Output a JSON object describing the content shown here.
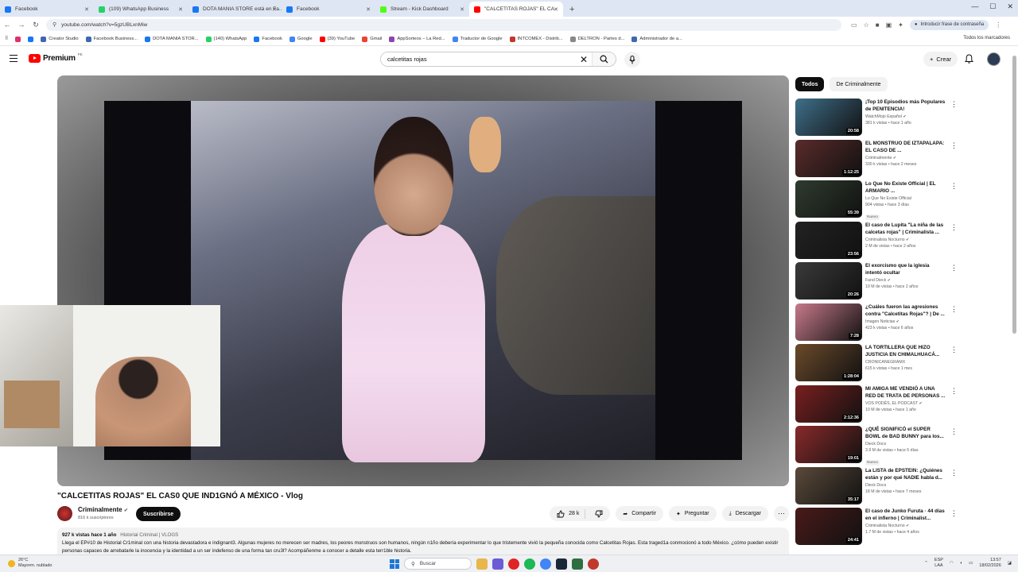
{
  "browser": {
    "tabs": [
      {
        "title": "Facebook",
        "color": "#1877f2"
      },
      {
        "title": "(109) WhatsApp Business",
        "color": "#25d366"
      },
      {
        "title": "DOTA MANIA STORE está en Fa...",
        "color": "#1877f2"
      },
      {
        "title": "Facebook",
        "color": "#1877f2"
      },
      {
        "title": "Stream - Kick Dashboard",
        "color": "#53fc18"
      },
      {
        "title": "\"CALCETITAS ROJAS\" EL CA",
        "color": "#ff0000"
      }
    ],
    "new_tab": "+",
    "url": "youtube.com/watch?v=5gzUBLxnMiw",
    "profile_label": "Introducir frase de contraseña",
    "bookmarks": [
      {
        "label": "",
        "color": "#e1306c"
      },
      {
        "label": "",
        "color": "#1877f2"
      },
      {
        "label": "Creator Studio",
        "color": "#4267b2"
      },
      {
        "label": "Facebook Business...",
        "color": "#4267b2"
      },
      {
        "label": "DOTA MANIA STOR...",
        "color": "#1877f2"
      },
      {
        "label": "(140) WhatsApp",
        "color": "#25d366"
      },
      {
        "label": "Facebook",
        "color": "#1877f2"
      },
      {
        "label": "Google",
        "color": "#4285f4"
      },
      {
        "label": "(39) YouTube",
        "color": "#ff0000"
      },
      {
        "label": "Gmail",
        "color": "#ea4335"
      },
      {
        "label": "AppSorteos – La Red...",
        "color": "#8e44ad"
      },
      {
        "label": "Traductor de Google",
        "color": "#4285f4"
      },
      {
        "label": "INTCOMEX - Distrib...",
        "color": "#c0392b"
      },
      {
        "label": "DELTRON - Partes d...",
        "color": "#888888"
      },
      {
        "label": "Administrador de a...",
        "color": "#4267b2"
      }
    ],
    "all_bookmarks": "Todos los marcadores"
  },
  "youtube": {
    "logo_text": "Premium",
    "logo_sup": "PE",
    "search_value": "calcetitas rojas",
    "create_label": "Crear",
    "video_title": "\"CALCETITAS ROJAS\" EL CAS0 QUE IND1GNÓ A MÉXICO - Vlog",
    "channel": {
      "name": "Criminalmente",
      "subs": "816 k suscriptores",
      "subscribe": "Suscribirse"
    },
    "likes": "28 k",
    "share": "Compartir",
    "ask": "Preguntar",
    "download": "Descargar",
    "desc_meta": "927 k vistas  hace 1 año",
    "desc_tag": "Historial Criminal | VLOGS",
    "desc_text": "Llega el EP#10 de Historial Cr1minal con una historia devastadora e indignant3. Algunas mujeres no merecen ser madres, los peores monstruos son humanos, ningún n1ño debería experimentar lo que tristemente vivió la pequeña conocida como Calcetitas Rojas. Esta traged1a conmocionó a todo México. ¿cómo pueden existir personas capaces de arrebatarle la inocencia y la identidad a un ser indefenso de una forma tan cru3l? Acompáñenme a conocer a detalle esta terr1ble historia."
  },
  "sidebar": {
    "chips": [
      "Todos",
      "De Criminalmente"
    ],
    "items": [
      {
        "title": "¡Top 10 Episodios más Populares de PENITENCIA!",
        "channel": "WatchMojo Español",
        "verified": "✔",
        "meta": "381 k vistas • hace 1 año",
        "badge": "",
        "duration": "20:58",
        "thumb": "#3f6f8a"
      },
      {
        "title": "EL MONSTRUO DE IZTAPALAPA: EL CASO DE ...",
        "channel": "Criminalmente",
        "verified": "✔",
        "meta": "330 k vistas • hace 2 meses",
        "badge": "",
        "duration": "1:12:25",
        "thumb": "#5a2b2b"
      },
      {
        "title": "Lo Que No Existe Official | EL ARMARIO ...",
        "channel": "Lo Que No Existe Official",
        "verified": "",
        "meta": "904 vistas • hace 3 días",
        "badge": "Nuevo",
        "duration": "55:39",
        "thumb": "#2f3b2f"
      },
      {
        "title": "El caso de Lupita \"La niña de las calcetas rojas\" | Criminalista ...",
        "channel": "Criminalista Nocturno",
        "verified": "✔",
        "meta": "2 M de vistas • hace 2 años",
        "badge": "",
        "duration": "23:56",
        "thumb": "#222222"
      },
      {
        "title": "El exorcismo que la iglesia intentó ocultar",
        "channel": "Fand Dieck",
        "verified": "✔",
        "meta": "10 M de vistas • hace 2 años",
        "badge": "",
        "duration": "20:26",
        "thumb": "#3a3a3a"
      },
      {
        "title": "¿Cuáles fueron las agresiones contra \"Calcetitas Rojas\"? | De ...",
        "channel": "Imagen Noticias",
        "verified": "✔",
        "meta": "423 k vistas • hace 6 años",
        "badge": "",
        "duration": "7:28",
        "thumb": "#c77a8a"
      },
      {
        "title": "LA TORTILLERA QUE HIZO JUSTICIA EN CHIMALHUACÁ...",
        "channel": "CRONICANEGRAMX",
        "verified": "",
        "meta": "615 k vistas • hace 1 mes",
        "badge": "",
        "duration": "1:28:04",
        "thumb": "#6b4a2a"
      },
      {
        "title": "MI AMIGA ME VENDIÓ A UNA RED DE TRATA DE PERSONAS ...",
        "channel": "VOS PODÉS, EL PODCAST",
        "verified": "✔",
        "meta": "10 M de vistas • hace 1 año",
        "badge": "",
        "duration": "2:12:36",
        "thumb": "#7a1f1f"
      },
      {
        "title": "¿QUÉ SIGNIFICÓ el SUPER BOWL de BAD BUNNY para los...",
        "channel": "Dieck Docs",
        "verified": "",
        "meta": "3.9 M de vistas • hace 5 días",
        "badge": "Nuevo",
        "duration": "19:01",
        "thumb": "#8a2a2a"
      },
      {
        "title": "La LISTA de EPSTEIN: ¿Quiénes están y por qué NADIE habla d...",
        "channel": "Dieck Docs",
        "verified": "",
        "meta": "18 M de vistas • hace 7 meses",
        "badge": "",
        "duration": "35:17",
        "thumb": "#5a4a3a"
      },
      {
        "title": "El caso de Junko Furuta · 44 días en el infierno | Criminalist...",
        "channel": "Criminalista Nocturno",
        "verified": "✔",
        "meta": "1.7 M de vistas • hace 4 años",
        "badge": "",
        "duration": "24:41",
        "thumb": "#4a1a1a"
      }
    ]
  },
  "taskbar": {
    "temp": "26°C",
    "weather": "Mayorm. nublado",
    "search": "Buscar",
    "lang1": "ESP",
    "lang2": "LAA",
    "time": "13:57",
    "date": "18/02/2026"
  }
}
